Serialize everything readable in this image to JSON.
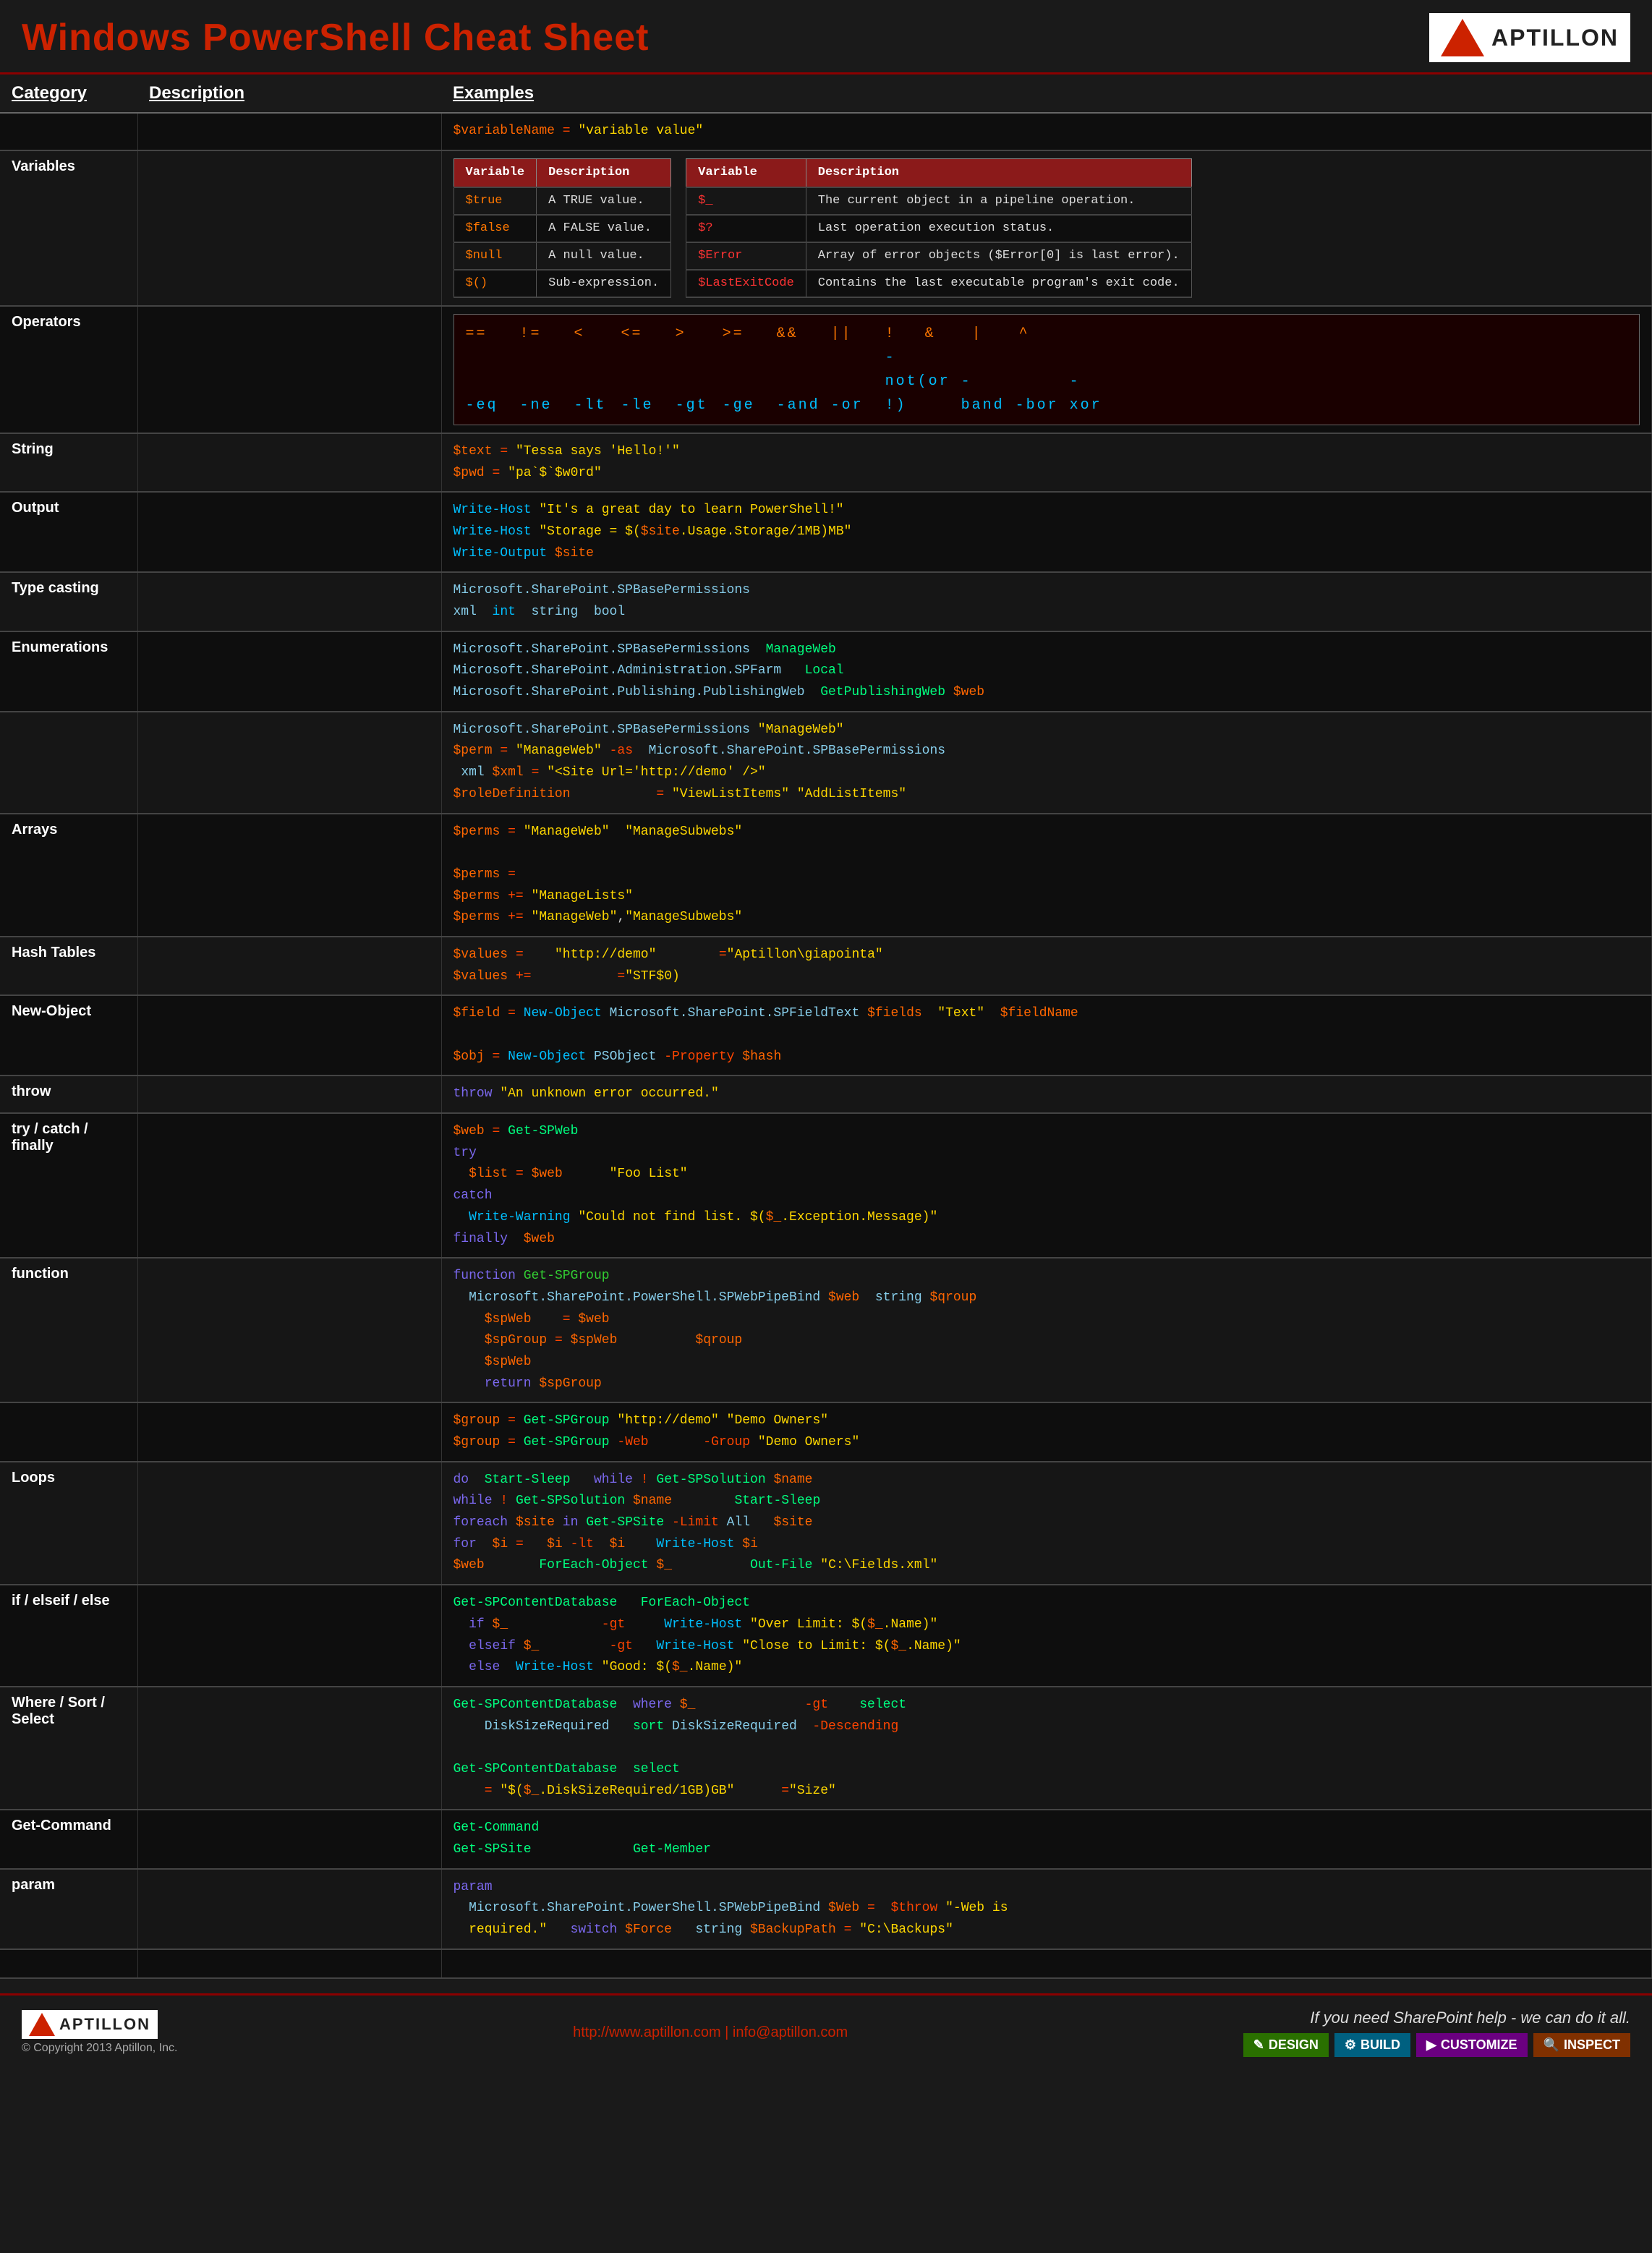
{
  "header": {
    "title": "Windows PowerShell Cheat Sheet",
    "logo_text": "APTILLON"
  },
  "columns": {
    "category": "Category",
    "description": "Description",
    "examples": "Examples"
  },
  "footer": {
    "logo_text": "APTILLON",
    "copyright": "© Copyright 2013 Aptillon, Inc.",
    "url": "http://www.aptillon.com  |  info@aptillon.com",
    "tagline": "If you need SharePoint help - we can do it all.",
    "badges": [
      "DESIGN",
      "BUILD",
      "CUSTOMIZE",
      "INSPECT"
    ]
  }
}
